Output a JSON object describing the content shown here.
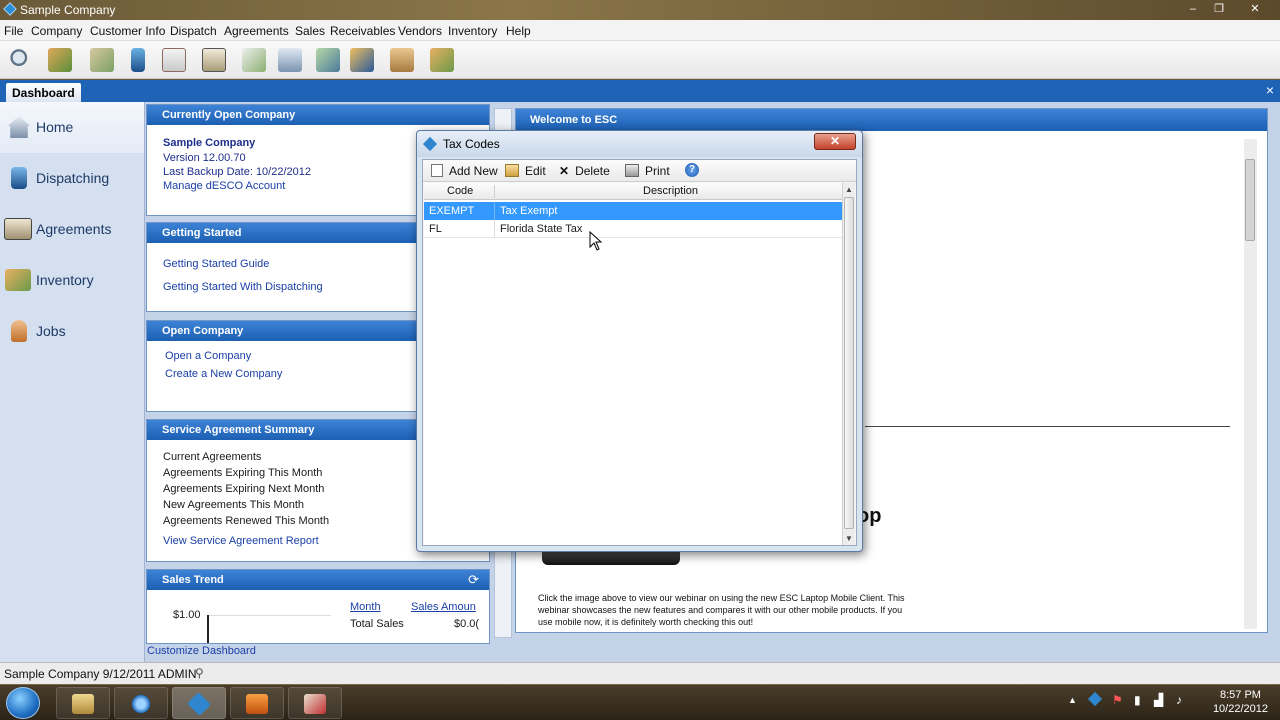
{
  "window": {
    "title": "Sample Company",
    "controls": [
      "–",
      "❐",
      "✕"
    ]
  },
  "menu": [
    "File",
    "Company",
    "Customer Info",
    "Dispatch",
    "Agreements",
    "Sales",
    "Receivables",
    "Vendors",
    "Inventory",
    "Help"
  ],
  "toolbar_icons": [
    "search-icon",
    "customers-icon",
    "contacts-icon",
    "dispatch-icon",
    "calendar-icon",
    "agreements-icon",
    "invoice-icon",
    "report-icon",
    "receivables-icon",
    "purchase-icon",
    "shipping-icon",
    "inventory-icon"
  ],
  "tabs": {
    "dashboard": "Dashboard",
    "close": "×"
  },
  "nav": {
    "items": [
      {
        "label": "Home",
        "icon": "home-icon"
      },
      {
        "label": "Dispatching",
        "icon": "dispatching-icon"
      },
      {
        "label": "Agreements",
        "icon": "agreements-icon"
      },
      {
        "label": "Inventory",
        "icon": "inventory-icon"
      },
      {
        "label": "Jobs",
        "icon": "jobs-icon"
      }
    ]
  },
  "company_panel": {
    "header": "Currently Open Company",
    "name": "Sample Company",
    "version": "Version 12.00.70",
    "backup": "Last Backup Date: 10/22/2012",
    "manage": "Manage dESCO Account"
  },
  "getting_started": {
    "header": "Getting Started",
    "guide": "Getting Started Guide",
    "dispatching": "Getting Started With Dispatching"
  },
  "open_company": {
    "header": "Open Company",
    "open": "Open a Company",
    "create": "Create a New Company"
  },
  "service_summary": {
    "header": "Service Agreement Summary",
    "rows": [
      "Current Agreements",
      "Agreements Expiring This Month",
      "Agreements Expiring Next Month",
      "New Agreements This Month",
      "Agreements Renewed This Month"
    ],
    "report_link": "View Service Agreement Report"
  },
  "sales_trend": {
    "header": "Sales Trend",
    "ytick": "$1.00",
    "col_month": "Month",
    "col_amount": "Sales Amoun",
    "total_label": "Total Sales",
    "total_value": "$0.0("
  },
  "customize": "Customize Dashboard",
  "welcome": {
    "header": "Welcome to ESC",
    "fragment": "op",
    "blurb": "Click the image above to view our webinar on using the new ESC Laptop Mobile Client. This webinar showcases the new features and compares it with our other mobile products. If you use mobile now, it is definitely worth checking this out!"
  },
  "status": {
    "text": "Sample Company  9/12/2011  ADMIN"
  },
  "dialog": {
    "title": "Tax Codes",
    "close": "✕",
    "toolbar": {
      "add": "Add New",
      "edit": "Edit",
      "delete": "Delete",
      "print": "Print"
    },
    "columns": {
      "code": "Code",
      "description": "Description"
    },
    "rows": [
      {
        "code": "EXEMPT",
        "description": "Tax Exempt",
        "selected": true
      },
      {
        "code": "FL",
        "description": "Florida State Tax",
        "selected": false
      }
    ]
  },
  "taskbar": {
    "apps": [
      "explorer-icon",
      "internet-explorer-icon",
      "esc-app-icon",
      "media-player-icon",
      "paint-icon"
    ],
    "time": "8:57 PM",
    "date": "10/22/2012"
  }
}
